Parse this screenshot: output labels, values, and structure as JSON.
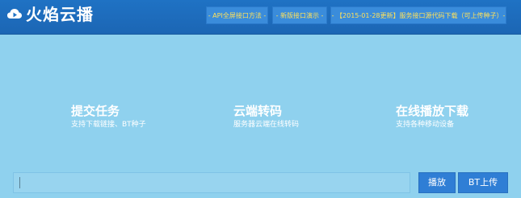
{
  "header": {
    "logo_text": "火焰云播",
    "nav": [
      {
        "label": "- API全屏接口方法 -"
      },
      {
        "label": "- 新版接口演示 -"
      },
      {
        "label": "- 【2015-01-28更新】服务接口源代码下载（可上传种子）-"
      }
    ]
  },
  "features": [
    {
      "title": "提交任务",
      "desc": "支持下载链接、BT种子"
    },
    {
      "title": "云端转码",
      "desc": "服务器云端在线转码"
    },
    {
      "title": "在线播放下载",
      "desc": "支持各种移动设备"
    }
  ],
  "input": {
    "value": "",
    "placeholder": ""
  },
  "buttons": {
    "play": "播放",
    "bt_upload": "BT上传"
  },
  "icons": {
    "logo": "cloud-play-icon"
  },
  "colors": {
    "header": "#1f72c4",
    "background": "#8fd1ee",
    "nav_text": "#ffe15a",
    "button": "#2f7ed5"
  }
}
